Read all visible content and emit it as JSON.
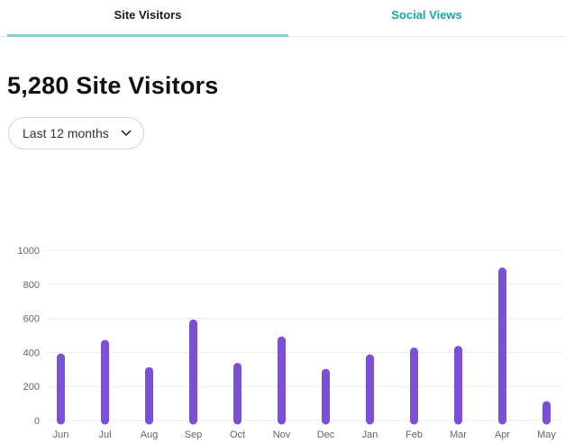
{
  "tabs": [
    {
      "label": "Site Visitors",
      "active": true
    },
    {
      "label": "Social Views",
      "active": false
    }
  ],
  "headline": "5,280 Site Visitors",
  "range_selector": {
    "selected": "Last 12 months",
    "icon": "chevron-down-icon"
  },
  "colors": {
    "accent": "#7fd3d6",
    "tab_inactive": "#19a6a6",
    "bar": "#7b4fd6"
  },
  "chart_data": {
    "type": "bar",
    "categories": [
      "Jun",
      "Jul",
      "Aug",
      "Sep",
      "Oct",
      "Nov",
      "Dec",
      "Jan",
      "Feb",
      "Mar",
      "Apr",
      "May"
    ],
    "values": [
      370,
      450,
      290,
      570,
      315,
      470,
      280,
      365,
      405,
      415,
      875,
      90
    ],
    "yticks": [
      0,
      200,
      400,
      600,
      800,
      1000
    ],
    "ylim": [
      0,
      1000
    ],
    "grid": true
  }
}
